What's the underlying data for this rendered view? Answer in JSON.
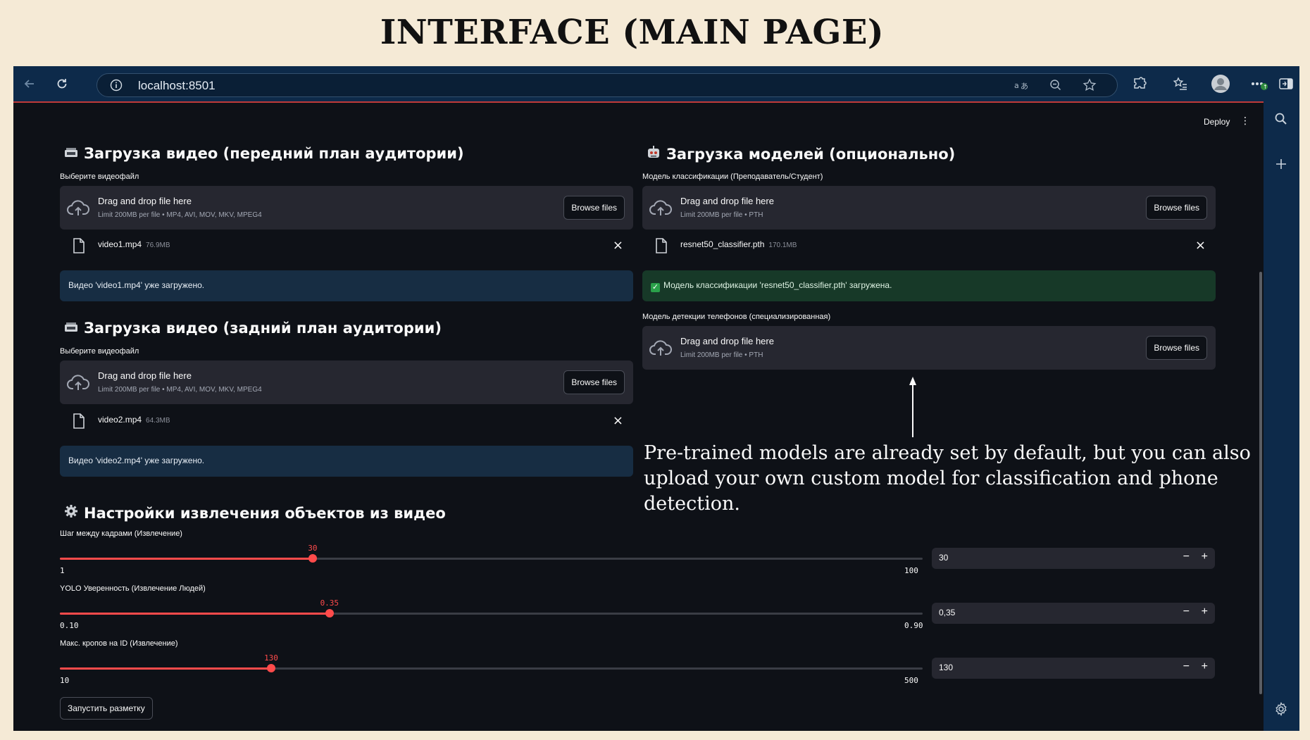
{
  "slide_title": "INTERFACE (MAIN PAGE)",
  "browser": {
    "url": "localhost:8501"
  },
  "header": {
    "deploy_label": "Deploy",
    "menu_glyph": "⋮"
  },
  "front_video": {
    "title": "Загрузка видео (передний план аудитории)",
    "label": "Выберите видеофайл",
    "dropzone_title": "Drag and drop file here",
    "dropzone_sub": "Limit 200MB per file • MP4, AVI, MOV, MKV, MPEG4",
    "browse_label": "Browse files",
    "file_name": "video1.mp4",
    "file_size": "76.9MB",
    "info": "Видео 'video1.mp4' уже загружено."
  },
  "back_video": {
    "title": "Загрузка видео (задний план аудитории)",
    "label": "Выберите видеофайл",
    "dropzone_title": "Drag and drop file here",
    "dropzone_sub": "Limit 200MB per file • MP4, AVI, MOV, MKV, MPEG4",
    "browse_label": "Browse files",
    "file_name": "video2.mp4",
    "file_size": "64.3MB",
    "info": "Видео 'video2.mp4' уже загружено."
  },
  "models": {
    "title": "Загрузка моделей (опционально)",
    "classifier_label": "Модель классификации (Преподаватель/Студент)",
    "dropzone_title": "Drag and drop file here",
    "dropzone_sub": "Limit 200MB per file • PTH",
    "browse_label": "Browse files",
    "file_name": "resnet50_classifier.pth",
    "file_size": "170.1MB",
    "success": "Модель классификации 'resnet50_classifier.pth' загружена.",
    "phone_label": "Модель детекции телефонов (специализированная)",
    "phone_dropzone_title": "Drag and drop file here",
    "phone_dropzone_sub": "Limit 200MB per file • PTH",
    "phone_browse_label": "Browse files"
  },
  "annotation": "Pre-trained models are already set by default, but you can also upload your own custom model for classification and phone detection.",
  "settings": {
    "title": "Настройки извлечения объектов из видео",
    "sliders": [
      {
        "label": "Шаг между кадрами (Извлечение)",
        "value": 30,
        "value_text": "30",
        "min": 1,
        "max": 100,
        "min_text": "1",
        "max_text": "100",
        "input_text": "30"
      },
      {
        "label": "YOLO Уверенность (Извлечение Людей)",
        "value": 0.35,
        "value_text": "0.35",
        "min": 0.1,
        "max": 0.9,
        "min_text": "0.10",
        "max_text": "0.90",
        "input_text": "0,35"
      },
      {
        "label": "Макс. кропов на ID (Извлечение)",
        "value": 130,
        "value_text": "130",
        "min": 10,
        "max": 500,
        "min_text": "10",
        "max_text": "500",
        "input_text": "130"
      }
    ],
    "minus": "−",
    "plus": "+"
  },
  "run_button": "Запустить разметку",
  "colors": {
    "accent": "#ff4b4b",
    "info_bg": "#172d43",
    "success_bg": "#173928",
    "chrome": "#0d2a4a"
  }
}
